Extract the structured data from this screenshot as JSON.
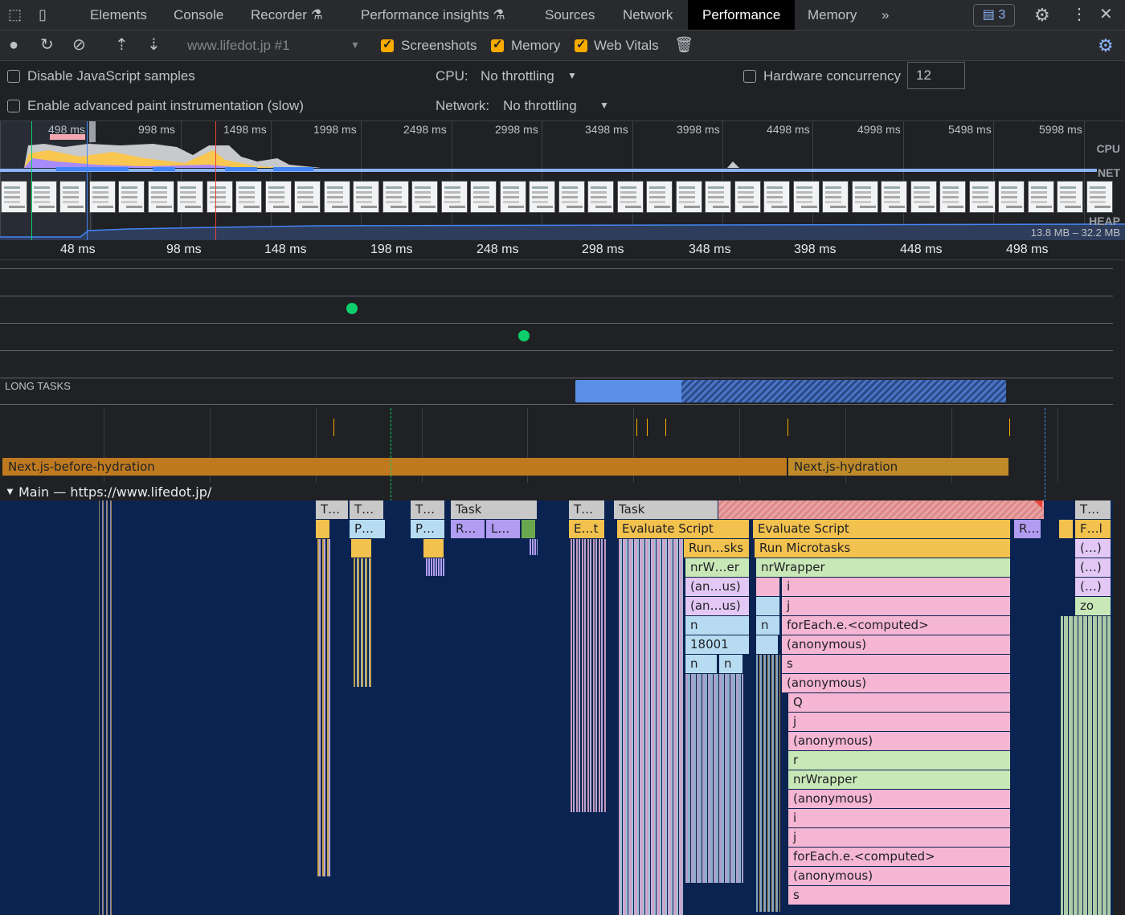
{
  "tabs": {
    "elements": "Elements",
    "console": "Console",
    "recorder": "Recorder",
    "perf_insights": "Performance insights",
    "sources": "Sources",
    "network": "Network",
    "performance": "Performance",
    "memory": "Memory",
    "more": "»",
    "issues_count": "3"
  },
  "toolbar": {
    "profile_select": "www.lifedot.jp #1",
    "screenshots_label": "Screenshots",
    "memory_label": "Memory",
    "webvitals_label": "Web Vitals"
  },
  "settings": {
    "disable_js": "Disable JavaScript samples",
    "enable_paint": "Enable advanced paint instrumentation (slow)",
    "cpu_label": "CPU:",
    "cpu_value": "No throttling",
    "network_label": "Network:",
    "network_value": "No throttling",
    "hw_label": "Hardware concurrency",
    "hw_value": "12"
  },
  "overview": {
    "ticks": [
      "498 ms",
      "998 ms",
      "1498 ms",
      "1998 ms",
      "2498 ms",
      "2998 ms",
      "3498 ms",
      "3998 ms",
      "4498 ms",
      "4998 ms",
      "5498 ms",
      "5998 ms"
    ],
    "cpu_label": "CPU",
    "net_label": "NET",
    "heap_label": "HEAP",
    "heap_range": "13.8 MB – 32.2 MB"
  },
  "ruler": {
    "ticks": [
      "48 ms",
      "98 ms",
      "148 ms",
      "198 ms",
      "248 ms",
      "298 ms",
      "348 ms",
      "398 ms",
      "448 ms",
      "498 ms"
    ]
  },
  "tracks": {
    "long_tasks": "LONG TASKS",
    "timing_before": "Next.js-before-hydration",
    "timing_hydration": "Next.js-hydration",
    "main_label": "Main — https://www.lifedot.jp/"
  },
  "flame": {
    "row0": [
      "T…",
      "T…",
      "T…",
      "Task",
      "T…",
      "Task",
      "T…"
    ],
    "row1": [
      "P…",
      "P…",
      "R…",
      "L…",
      "E…t",
      "Evaluate Script",
      "Evaluate Script",
      "R…",
      "F…l"
    ],
    "row2": [
      "Run…sks",
      "Run Microtasks",
      "(…)"
    ],
    "row3": [
      "nrW…er",
      "nrWrapper",
      "(…)"
    ],
    "row4": [
      "(an…us)",
      "i",
      "(…)"
    ],
    "row5": [
      "(an…us)",
      "j",
      "zo"
    ],
    "row6": [
      "n",
      "n",
      "forEach.e.<computed>"
    ],
    "row7": [
      "18001",
      "(anonymous)"
    ],
    "row8": [
      "n",
      "n",
      "s"
    ],
    "right_stack": [
      "(anonymous)",
      "Q",
      "j",
      "(anonymous)",
      "r",
      "nrWrapper",
      "(anonymous)",
      "i",
      "j",
      "forEach.e.<computed>",
      "(anonymous)",
      "s"
    ]
  },
  "colors": {
    "task_gray": "#c8c8c8",
    "script_yellow": "#f2c14e",
    "pink": "#f5b6d3",
    "green": "#c9e8b8",
    "blue": "#b7dcf2",
    "purple": "#b09cf0",
    "timing": "#bf7a1f",
    "long_task": "#5a8fe8"
  }
}
